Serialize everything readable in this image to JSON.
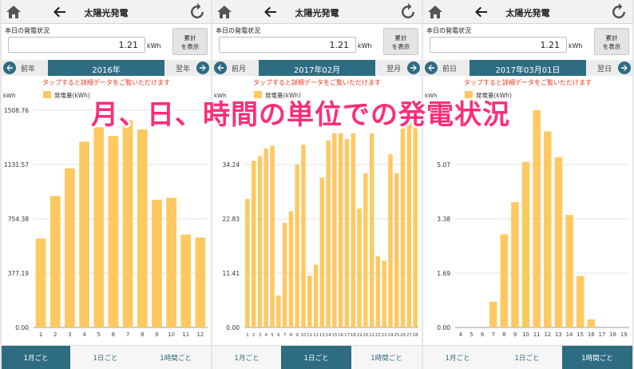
{
  "app": {
    "title": "太陽光発電",
    "today_label": "本日の発電状況",
    "today_value": "1.21",
    "unit": "kWh",
    "sum_button": [
      "累計",
      "を表示"
    ],
    "hint": "タップすると詳細データをご覧いただけます"
  },
  "overlay_text": "月、日、時間の単位での発電状況",
  "colors": {
    "accent": "#2e6c82",
    "bar": "#ffc860",
    "hint": "#e83a1f",
    "overlay": "#ff2d78"
  },
  "icons": [
    "home-icon",
    "back-arrow-icon",
    "refresh-icon",
    "prev-circle-icon",
    "next-circle-icon"
  ],
  "tabs": [
    "1月ごと",
    "1日ごと",
    "1時間ごと"
  ],
  "panels": [
    {
      "prev": "前年",
      "next": "翌年",
      "period": "2016年",
      "active_tab": 0
    },
    {
      "prev": "前月",
      "next": "翌月",
      "period": "2017年02月",
      "active_tab": 1
    },
    {
      "prev": "前日",
      "next": "翌日",
      "period": "2017年03月01日",
      "active_tab": 2
    }
  ],
  "chart_data": [
    {
      "type": "bar",
      "ylabel": "kWh",
      "legend": "発電量(kWh)",
      "yticks": [
        "0.00",
        "377.19",
        "754.38",
        "1131.57",
        "1508.76"
      ],
      "ylim": [
        0,
        1508.76
      ],
      "categories": [
        "1",
        "2",
        "3",
        "4",
        "5",
        "6",
        "7",
        "8",
        "9",
        "10",
        "11",
        "12"
      ],
      "values": [
        618,
        913,
        1105,
        1290,
        1390,
        1330,
        1440,
        1375,
        886,
        900,
        645,
        624
      ]
    },
    {
      "type": "bar",
      "ylabel": "kWh",
      "legend": "発電量(kWh)",
      "yticks": [
        "0.00",
        "11.41",
        "22.83",
        "34.24"
      ],
      "ylim": [
        0,
        45.65
      ],
      "categories": [
        "1",
        "2",
        "3",
        "4",
        "5",
        "6",
        "7",
        "8",
        "9",
        "10",
        "11",
        "12",
        "13",
        "14",
        "15",
        "16",
        "17",
        "18",
        "19",
        "20",
        "21",
        "22",
        "23",
        "24",
        "25",
        "26",
        "27",
        "28"
      ],
      "values": [
        27.0,
        35.0,
        36.0,
        37.6,
        38.2,
        6.7,
        22.0,
        24.4,
        34.2,
        38.4,
        10.9,
        13.2,
        31.5,
        39.3,
        40.8,
        40.8,
        39.6,
        40.8,
        25.0,
        32.4,
        40.8,
        15.0,
        14.0,
        36.4,
        32.4,
        45.0,
        45.0,
        45.0
      ]
    },
    {
      "type": "bar",
      "ylabel": "kWh",
      "legend": "発電量(kWh)",
      "yticks": [
        "0.00",
        "1.69",
        "3.38",
        "5.07"
      ],
      "ylim": [
        0,
        6.76
      ],
      "categories": [
        "4",
        "5",
        "6",
        "7",
        "8",
        "9",
        "10",
        "11",
        "12",
        "13",
        "14",
        "15",
        "16",
        "17",
        "18",
        "19"
      ],
      "values": [
        0,
        0,
        0,
        0.8,
        2.9,
        3.9,
        5.15,
        6.76,
        6.1,
        5.3,
        3.5,
        1.6,
        0.25,
        0,
        0,
        0
      ]
    }
  ]
}
